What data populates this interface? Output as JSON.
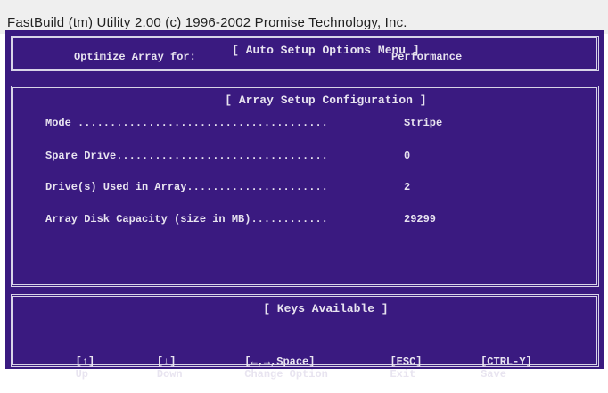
{
  "window": {
    "title": "FastBuild (tm) Utility 2.00 (c) 1996-2002 Promise Technology, Inc."
  },
  "auto_setup": {
    "title": "[ Auto Setup Options Menu ]",
    "optimize_label": "Optimize Array for:",
    "optimize_value": "Performance"
  },
  "array_setup": {
    "title": "[ Array Setup Configuration ]",
    "rows": [
      {
        "label": "Mode .......................................",
        "value": "Stripe"
      },
      {
        "label": "Spare Drive.................................",
        "value": "0"
      },
      {
        "label": "Drive(s) Used in Array......................",
        "value": "2"
      },
      {
        "label": "Array Disk Capacity (size in MB)............",
        "value": "29299"
      }
    ]
  },
  "keys": {
    "title": "[ Keys Available ]",
    "items": [
      {
        "key": "[↑]",
        "action": "Up"
      },
      {
        "key": "[↓]",
        "action": "Down"
      },
      {
        "key": "[←,→,Space]",
        "action": "Change Option"
      },
      {
        "key": "[ESC]",
        "action": "Exit"
      },
      {
        "key": "[CTRL-Y]",
        "action": "Save"
      }
    ]
  },
  "colors": {
    "background": "#3a1a80",
    "text": "#e8e4f0",
    "title_bar": "#efefef"
  }
}
